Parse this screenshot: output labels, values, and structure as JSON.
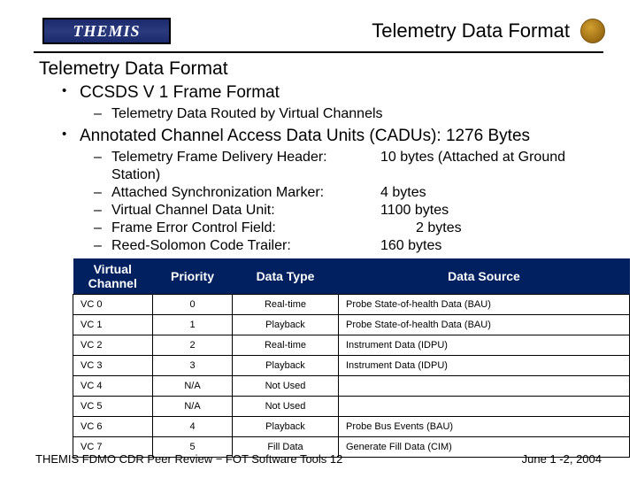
{
  "header": {
    "logo_text": "THEMIS",
    "title": "Telemetry Data Format"
  },
  "slide": {
    "title": "Telemetry Data Format",
    "b1": {
      "text": "CCSDS V 1 Frame Format",
      "sub1": "Telemetry Data Routed by Virtual Channels"
    },
    "b2": {
      "text": "Annotated Channel Access Data Units (CADUs): 1276 Bytes",
      "items": [
        {
          "label": "Telemetry Frame Delivery Header:",
          "value": "10 bytes  (Attached at Ground"
        },
        {
          "label": "Station)",
          "value": ""
        },
        {
          "label": "Attached Synchronization Marker:",
          "value": "4 bytes"
        },
        {
          "label": "Virtual Channel Data Unit:",
          "value": "1100 bytes"
        },
        {
          "label": "Frame Error Control Field:",
          "value": "2 bytes"
        },
        {
          "label": "Reed-Solomon Code Trailer:",
          "value": "160 bytes"
        }
      ]
    }
  },
  "table": {
    "headers": [
      "Virtual Channel",
      "Priority",
      "Data Type",
      "Data Source"
    ],
    "rows": [
      [
        "VC 0",
        "0",
        "Real-time",
        "Probe State-of-health Data (BAU)"
      ],
      [
        "VC 1",
        "1",
        "Playback",
        "Probe State-of-health Data (BAU)"
      ],
      [
        "VC 2",
        "2",
        "Real-time",
        "Instrument Data (IDPU)"
      ],
      [
        "VC 3",
        "3",
        "Playback",
        "Instrument Data (IDPU)"
      ],
      [
        "VC 4",
        "N/A",
        "Not Used",
        ""
      ],
      [
        "VC 5",
        "N/A",
        "Not Used",
        ""
      ],
      [
        "VC 6",
        "4",
        "Playback",
        "Probe Bus Events (BAU)"
      ],
      [
        "VC 7",
        "5",
        "Fill Data",
        "Generate Fill Data (CIM)"
      ]
    ]
  },
  "footer": {
    "left": "THEMIS FDMO CDR Peer Review − FOT Software Tools 12",
    "right": "June 1 -2, 2004"
  }
}
